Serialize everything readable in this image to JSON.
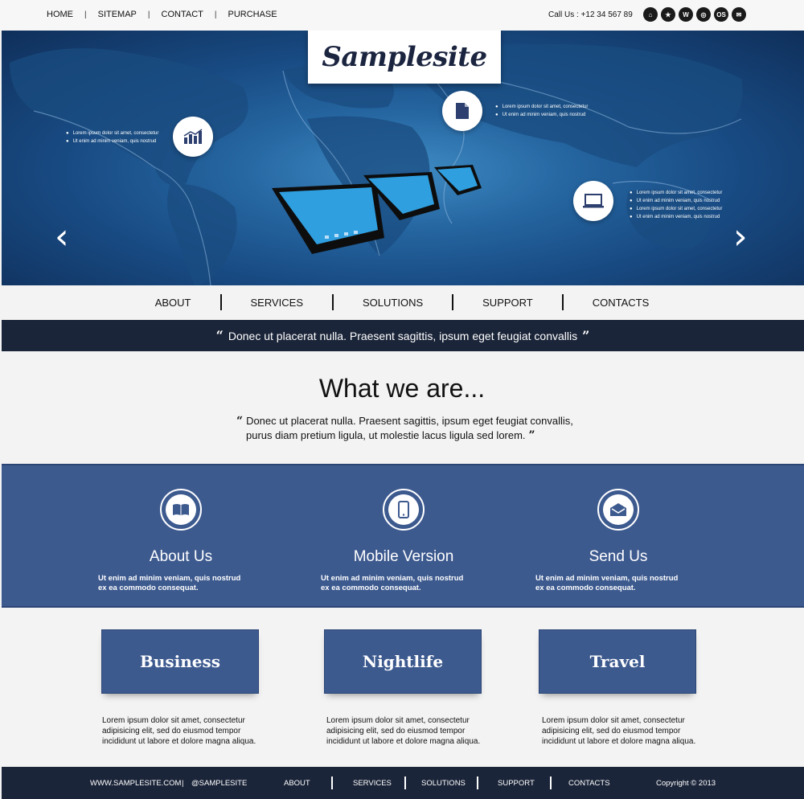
{
  "topbar": {
    "nav": [
      "HOME",
      "SITEMAP",
      "CONTACT",
      "PURCHASE"
    ],
    "separator": "|",
    "call_us": "Call Us : +12 34 567 89",
    "social_icons": [
      {
        "name": "home-icon",
        "glyph": "⌂"
      },
      {
        "name": "star-icon",
        "glyph": "★"
      },
      {
        "name": "wordpress-icon",
        "glyph": "W"
      },
      {
        "name": "target-icon",
        "glyph": "◎"
      },
      {
        "name": "os-icon",
        "glyph": "OS"
      },
      {
        "name": "mail-icon",
        "glyph": "✉"
      }
    ]
  },
  "logo": "Samplesite",
  "hero": {
    "left_bullets": [
      "Lorem ipsum dolor sit amet, consectetur",
      "Ut enim ad minim veniam, quis nostrud"
    ],
    "top_bullets": [
      "Lorem ipsum dolor sit amet, consectetur",
      "Ut enim ad minim veniam, quis nostrud"
    ],
    "right_bullets": [
      "Lorem ipsum dolor sit amet, consectetur",
      "Ut enim ad minim veniam, quis nostrud",
      "Lorem ipsum dolor sit amet, consectetur",
      "Ut enim ad minim veniam, quis nostrud"
    ],
    "prev_arrow": "‹",
    "next_arrow": "›"
  },
  "mainnav": [
    "ABOUT",
    "SERVICES",
    "SOLUTIONS",
    "SUPPORT",
    "CONTACTS"
  ],
  "quote": {
    "open": "“",
    "text": "Donec ut placerat nulla. Praesent sagittis, ipsum eget feugiat convallis",
    "close": "”"
  },
  "what_we_are": {
    "title": "What we are...",
    "line1": "Donec ut placerat nulla. Praesent sagittis, ipsum eget feugiat convallis,",
    "line2": "purus diam pretium ligula, ut molestie lacus ligula sed lorem."
  },
  "features": [
    {
      "title": "About Us",
      "desc1": "Ut enim ad minim veniam, quis nostrud",
      "desc2": "ex ea commodo consequat.",
      "icon": "book-icon"
    },
    {
      "title": "Mobile Version",
      "desc1": "Ut enim ad minim veniam, quis nostrud",
      "desc2": "ex ea commodo consequat.",
      "icon": "phone-icon"
    },
    {
      "title": "Send Us",
      "desc1": "Ut enim ad minim veniam, quis nostrud",
      "desc2": "ex ea commodo consequat.",
      "icon": "envelope-icon"
    }
  ],
  "cards": [
    {
      "title": "Business",
      "line1": "Lorem ipsum dolor sit amet, consectetur",
      "line2": "adipisicing elit, sed do eiusmod tempor",
      "line3": "incididunt ut labore et dolore magna aliqua."
    },
    {
      "title": "Nightlife",
      "line1": "Lorem ipsum dolor sit amet, consectetur",
      "line2": "adipisicing elit, sed do eiusmod tempor",
      "line3": "incididunt ut labore et dolore magna aliqua."
    },
    {
      "title": "Travel",
      "line1": "Lorem ipsum dolor sit amet, consectetur",
      "line2": "adipisicing elit, sed do eiusmod tempor",
      "line3": "incididunt ut labore et dolore magna aliqua."
    }
  ],
  "footer": {
    "website": "WWW.SAMPLESITE.COM",
    "sep": "|",
    "handle": "@SAMPLESITE",
    "nav": [
      "ABOUT",
      "SERVICES",
      "SOLUTIONS",
      "SUPPORT",
      "CONTACTS"
    ],
    "copyright": "Copyright © 2013"
  },
  "colors": {
    "navy": "#1b2539",
    "band_blue": "#3d5a8f",
    "hero_blue": "#2565a0",
    "background": "#f3f3f3"
  }
}
